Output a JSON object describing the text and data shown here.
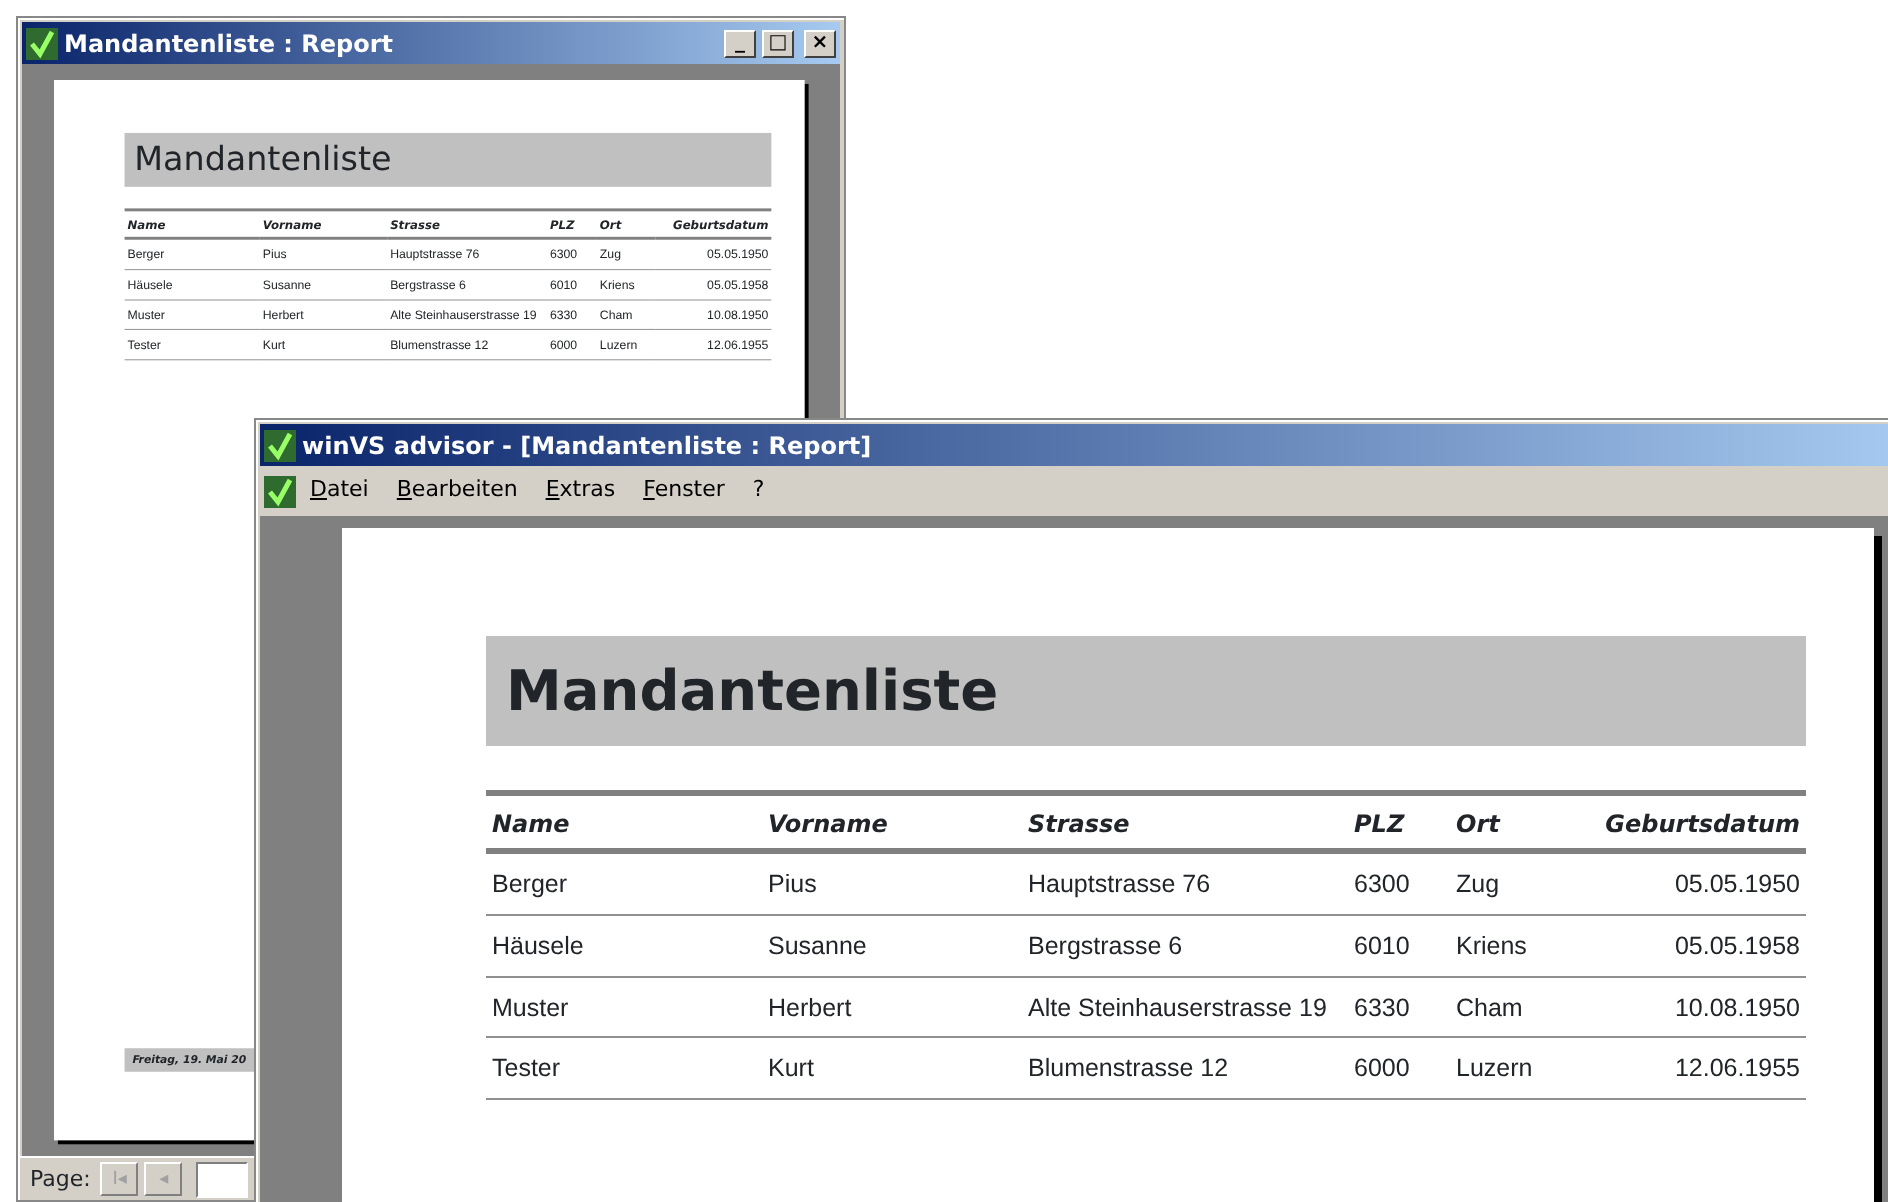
{
  "windows": [
    {
      "title": "Mandantenliste : Report",
      "controls": [
        "_",
        "□",
        "×"
      ],
      "report": {
        "title": "Mandantenliste",
        "columns": [
          "Name",
          "Vorname",
          "Strasse",
          "PLZ",
          "Ort",
          "Geburtsdatum"
        ],
        "rows": [
          [
            "Berger",
            "Pius",
            "Hauptstrasse 76",
            "6300",
            "Zug",
            "05.05.1950"
          ],
          [
            "Häusele",
            "Susanne",
            "Bergstrasse 6",
            "6010",
            "Kriens",
            "05.05.1958"
          ],
          [
            "Muster",
            "Herbert",
            "Alte Steinhauserstrasse 19",
            "6330",
            "Cham",
            "10.08.1950"
          ],
          [
            "Tester",
            "Kurt",
            "Blumenstrasse 12",
            "6000",
            "Luzern",
            "12.06.1955"
          ]
        ],
        "footer": "Freitag, 19. Mai 20"
      },
      "pager": {
        "label": "Page:",
        "buttons": [
          {
            "glyph": "I◂",
            "disabled": true
          },
          {
            "glyph": "◂",
            "disabled": true
          }
        ]
      }
    },
    {
      "title": "winVS advisor - [Mandantenliste : Report]",
      "menu": [
        "Datei",
        "Bearbeiten",
        "Extras",
        "Fenster",
        "?"
      ],
      "report": {
        "title": "Mandantenliste",
        "columns": [
          "Name",
          "Vorname",
          "Strasse",
          "PLZ",
          "Ort",
          "Geburtsdatum"
        ],
        "rows": [
          [
            "Berger",
            "Pius",
            "Hauptstrasse 76",
            "6300",
            "Zug",
            "05.05.1950"
          ],
          [
            "Häusele",
            "Susanne",
            "Bergstrasse 6",
            "6010",
            "Kriens",
            "05.05.1958"
          ],
          [
            "Muster",
            "Herbert",
            "Alte Steinhauserstrasse 19",
            "6330",
            "Cham",
            "10.08.1950"
          ],
          [
            "Tester",
            "Kurt",
            "Blumenstrasse 12",
            "6000",
            "Luzern",
            "12.06.1955"
          ]
        ]
      }
    }
  ]
}
